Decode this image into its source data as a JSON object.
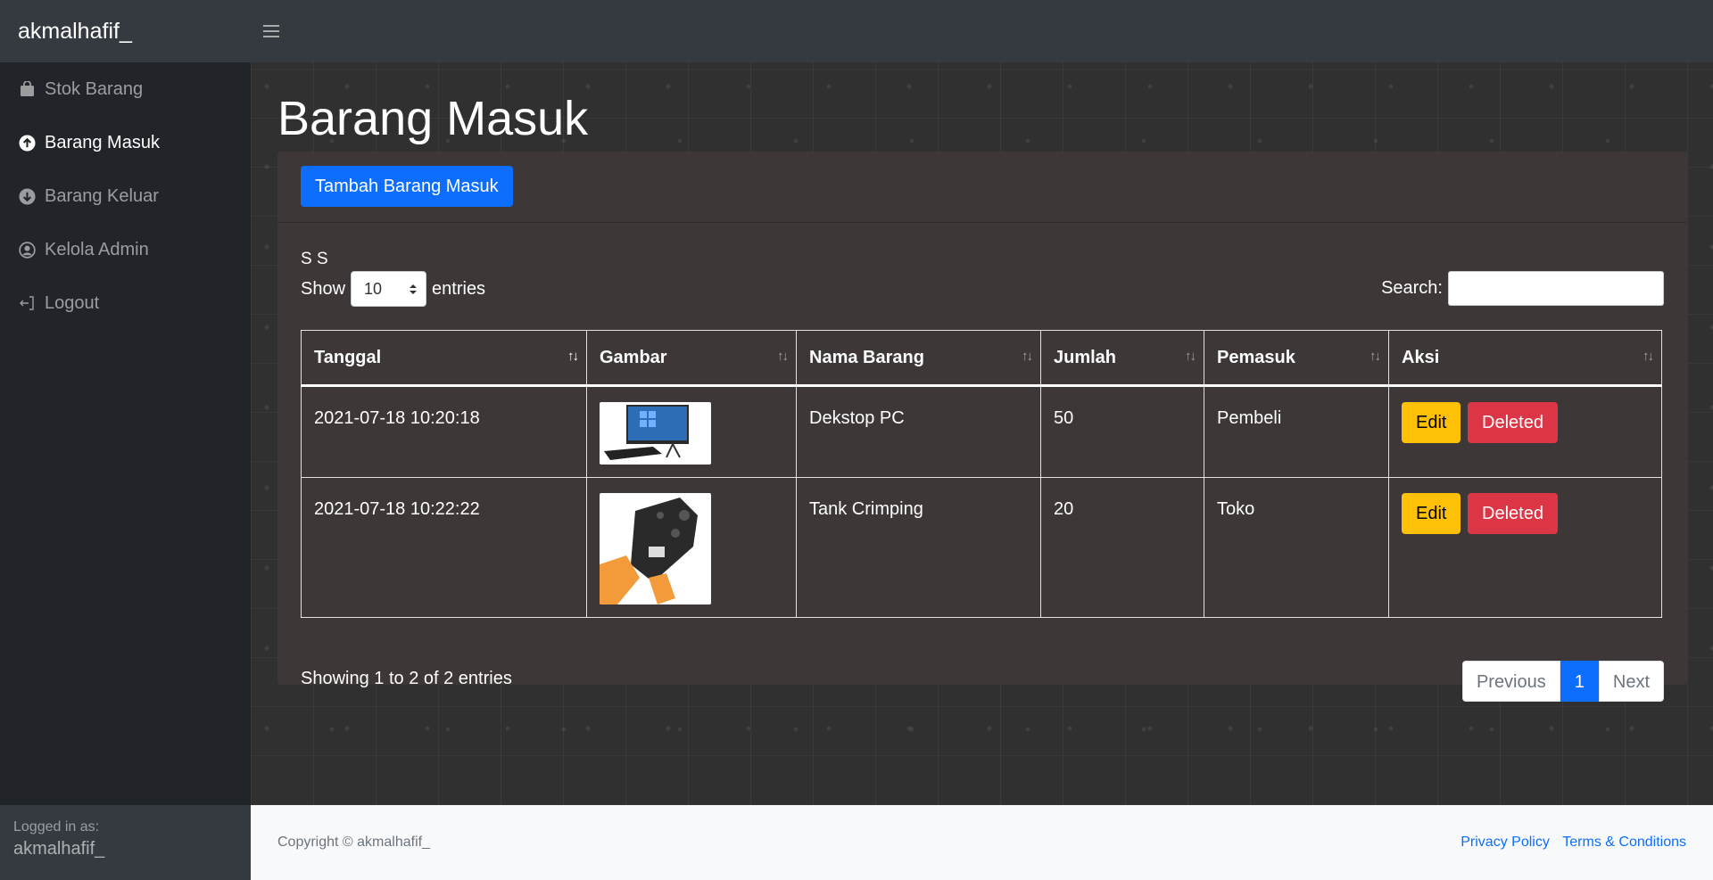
{
  "brand": "akmalhafif_",
  "sidebar": {
    "items": [
      {
        "label": "Stok Barang",
        "icon": "bag-icon"
      },
      {
        "label": "Barang Masuk",
        "icon": "arrow-up-circle-icon",
        "active": true
      },
      {
        "label": "Barang Keluar",
        "icon": "arrow-down-circle-icon"
      },
      {
        "label": "Kelola Admin",
        "icon": "user-circle-icon"
      },
      {
        "label": "Logout",
        "icon": "sign-out-icon"
      }
    ],
    "footer": {
      "logged_in_label": "Logged in as:",
      "user": "akmalhafif_"
    }
  },
  "page": {
    "title": "Barang Masuk",
    "add_button": "Tambah Barang Masuk",
    "ss_text": "S S",
    "show_label": "Show",
    "entries_value": "10",
    "entries_label": "entries",
    "search_label": "Search:"
  },
  "table": {
    "headers": [
      "Tanggal",
      "Gambar",
      "Nama Barang",
      "Jumlah",
      "Pemasuk",
      "Aksi"
    ],
    "rows": [
      {
        "tanggal": "2021-07-18 10:20:18",
        "gambar": "desktop-pc-image",
        "nama": "Dekstop PC",
        "jumlah": "50",
        "pemasuk": "Pembeli"
      },
      {
        "tanggal": "2021-07-18 10:22:22",
        "gambar": "crimping-tool-image",
        "nama": "Tank Crimping",
        "jumlah": "20",
        "pemasuk": "Toko"
      }
    ],
    "edit_label": "Edit",
    "delete_label": "Deleted"
  },
  "pagination": {
    "info": "Showing 1 to 2 of 2 entries",
    "previous": "Previous",
    "current": "1",
    "next": "Next"
  },
  "footer": {
    "copyright": "Copyright © akmalhafif_",
    "privacy": "Privacy Policy",
    "terms": "Terms & Conditions"
  },
  "colors": {
    "primary": "#0d6efd",
    "warning": "#ffc107",
    "danger": "#dc3545",
    "sidebar": "#212529",
    "navbar": "#343a40",
    "card": "#3d3837"
  }
}
